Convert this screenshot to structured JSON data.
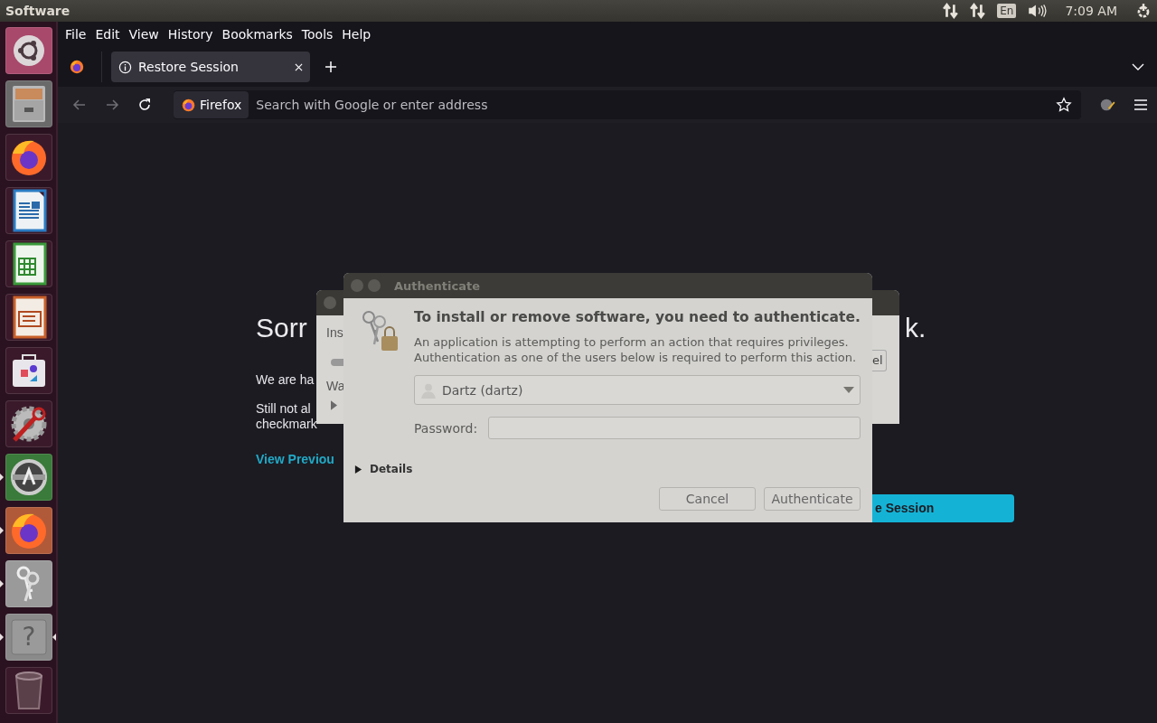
{
  "top_panel": {
    "title": "Software",
    "keyboard_layout": "En",
    "clock": "7:09 AM"
  },
  "launcher": {
    "items": [
      {
        "kind": "ubuntu",
        "running": false,
        "focused": false
      },
      {
        "kind": "files",
        "running": false,
        "focused": false
      },
      {
        "kind": "firefox",
        "running": false,
        "focused": false
      },
      {
        "kind": "writer",
        "running": false,
        "focused": false
      },
      {
        "kind": "calc",
        "running": false,
        "focused": false
      },
      {
        "kind": "impress",
        "running": false,
        "focused": false
      },
      {
        "kind": "store",
        "running": false,
        "focused": false
      },
      {
        "kind": "settings",
        "running": false,
        "focused": false
      },
      {
        "kind": "updater",
        "running": true,
        "focused": false
      },
      {
        "kind": "firefox-tile",
        "running": true,
        "focused": false
      },
      {
        "kind": "keys",
        "running": true,
        "focused": false
      },
      {
        "kind": "help",
        "glyph": "?",
        "running": true,
        "focused": true
      },
      {
        "kind": "trash",
        "running": false,
        "focused": false
      }
    ]
  },
  "browser": {
    "menu": [
      "File",
      "Edit",
      "View",
      "History",
      "Bookmarks",
      "Tools",
      "Help"
    ],
    "tabs": [
      {
        "label": "Restore Session",
        "selected": true
      }
    ],
    "identity_label": "Firefox",
    "address": {
      "placeholder": "Search with Google or enter address"
    },
    "page": {
      "heading_left": "Sorr",
      "heading_right": "k.",
      "para_1": "We are ha",
      "para_2_line_1": "Still not al",
      "para_2_line_2": "checkmark",
      "link": "View Previou",
      "button": "e Session"
    }
  },
  "back_window": {
    "label_1": "Ins",
    "label_2": "Wa",
    "button": "el"
  },
  "dialog": {
    "title": "Authenticate",
    "heading": "To install or remove software, you need to authenticate.",
    "description_lines": [
      "An application is attempting to perform an action that requires privileges.",
      "Authentication as one of the users below is required to perform this action."
    ],
    "user": "Dartz (dartz)",
    "password_label": "Password:",
    "details": {
      "label": "Details",
      "expanded": false
    },
    "buttons": [
      "Cancel",
      "Authenticate"
    ]
  }
}
